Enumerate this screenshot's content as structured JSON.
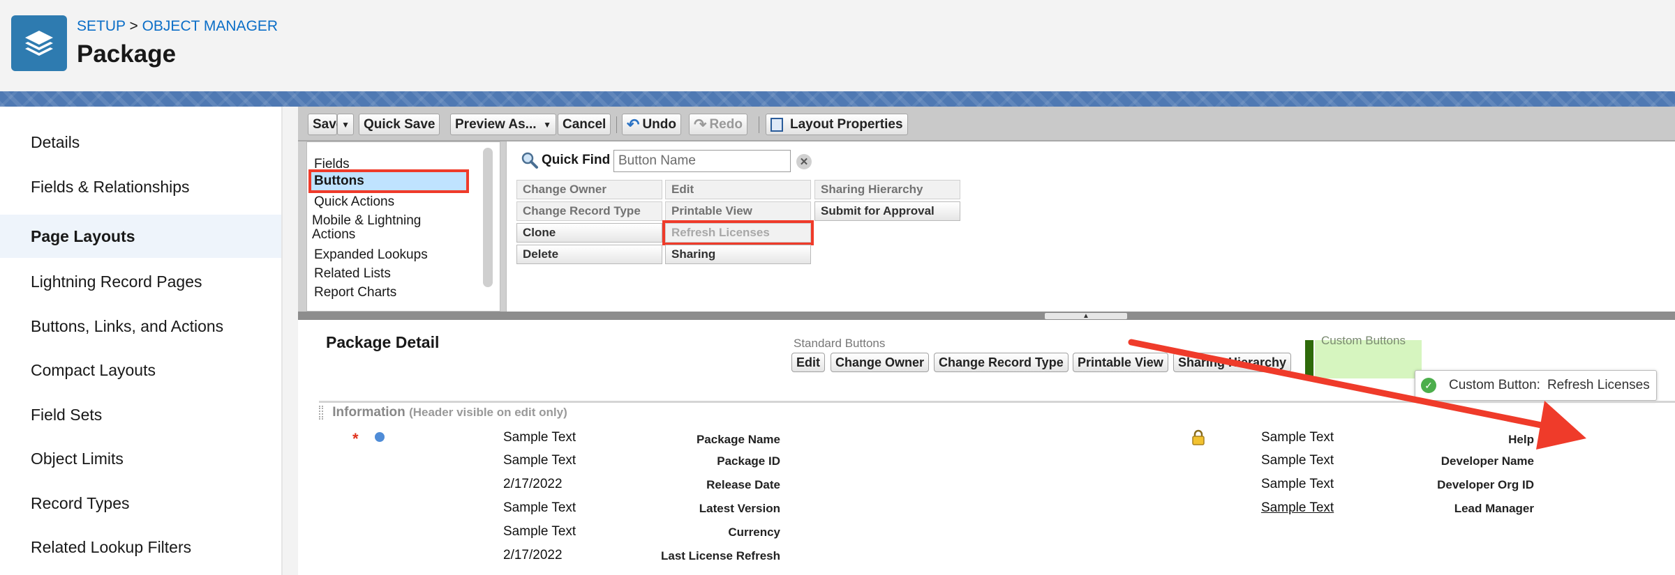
{
  "header": {
    "breadcrumb": {
      "setup": "SETUP",
      "separator": ">",
      "object_manager": "OBJECT MANAGER"
    },
    "title": "Package",
    "icon": "layers-icon",
    "icon_color": "#2e7bb0"
  },
  "sidebar": {
    "items": [
      {
        "label": "Details"
      },
      {
        "label": "Fields & Relationships"
      },
      {
        "label": "Page Layouts",
        "active": true
      },
      {
        "label": "Lightning Record Pages"
      },
      {
        "label": "Buttons, Links, and Actions"
      },
      {
        "label": "Compact Layouts"
      },
      {
        "label": "Field Sets"
      },
      {
        "label": "Object Limits"
      },
      {
        "label": "Record Types"
      },
      {
        "label": "Related Lookup Filters"
      }
    ]
  },
  "toolbar": {
    "save": "Save",
    "quick_save": "Quick Save",
    "preview_as": "Preview As...",
    "cancel": "Cancel",
    "undo": "Undo",
    "redo": "Redo",
    "layout_properties": "Layout Properties"
  },
  "palette": {
    "categories": [
      {
        "label": "Fields"
      },
      {
        "label": "Buttons",
        "selected": true
      },
      {
        "label": "Quick Actions"
      },
      {
        "label": "Mobile & Lightning Actions"
      },
      {
        "label": "Expanded Lookups"
      },
      {
        "label": "Related Lists"
      },
      {
        "label": "Report Charts"
      }
    ],
    "quick_find": {
      "label": "Quick Find",
      "placeholder": "Button Name"
    },
    "buttons": {
      "change_owner": "Change Owner",
      "edit": "Edit",
      "sharing_hierarchy": "Sharing Hierarchy",
      "change_record_type": "Change Record Type",
      "printable_view": "Printable View",
      "submit_for_approval": "Submit for Approval",
      "clone": "Clone",
      "refresh_licenses": "Refresh Licenses",
      "delete": "Delete",
      "sharing": "Sharing"
    }
  },
  "layout": {
    "section_title": "Package Detail",
    "standard_buttons_label": "Standard Buttons",
    "standard_buttons": {
      "edit": "Edit",
      "change_owner": "Change Owner",
      "change_record_type": "Change Record Type",
      "printable_view": "Printable View",
      "sharing_hierarchy": "Sharing Hierarchy"
    },
    "custom_buttons_label": "Custom Buttons",
    "tooltip": {
      "label": "Custom Button:",
      "value": "Refresh Licenses"
    },
    "information": {
      "title": "Information",
      "subtitle": "(Header visible on edit only)"
    },
    "required_marker": "*",
    "left_fields": [
      {
        "label": "Package Name",
        "value": "Sample Text"
      },
      {
        "label": "Package ID",
        "value": "Sample Text"
      },
      {
        "label": "Release Date",
        "value": "2/17/2022"
      },
      {
        "label": "Latest Version",
        "value": "Sample Text"
      },
      {
        "label": "Currency",
        "value": "Sample Text"
      },
      {
        "label": "Last License Refresh",
        "value": "2/17/2022"
      }
    ],
    "right_fields": [
      {
        "label": "Help",
        "value": "Sample Text"
      },
      {
        "label": "Developer Name",
        "value": "Sample Text"
      },
      {
        "label": "Developer Org ID",
        "value": "Sample Text"
      },
      {
        "label": "Lead Manager",
        "value": "Sample Text"
      }
    ]
  },
  "colors": {
    "link": "#0b6ec7",
    "annotation_red": "#ef3b2a",
    "custom_bar": "#2e6a0a",
    "custom_area": "#d6f5bf"
  }
}
